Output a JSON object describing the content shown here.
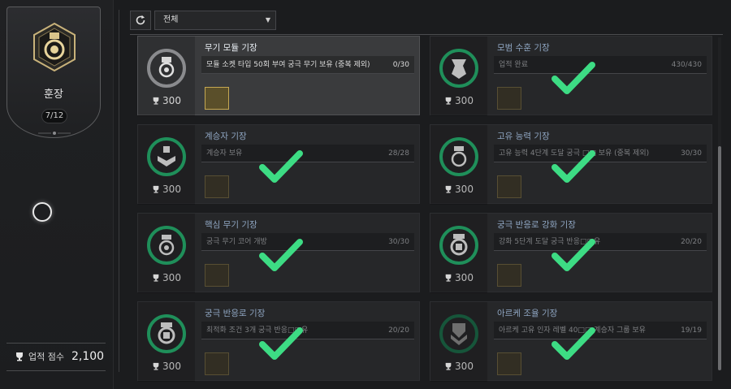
{
  "medal": {
    "title": "훈장",
    "count": "7/12"
  },
  "score": {
    "label": "업적 점수",
    "value": "2,100",
    "icon": "trophy-icon"
  },
  "filter": {
    "selected": "전체",
    "refresh_icon": "refresh-icon"
  },
  "colors": {
    "check": "#3ddc84",
    "emblem_ring": "#1f8f5a",
    "card_bg": "#262729"
  },
  "cards": [
    {
      "title": "무기 모듈 기장",
      "desc": "모듈 소켓 타입 50회 부여 궁극 무기 보유 (중복 제외)",
      "progress": "0/30",
      "reward": "300",
      "completed": false,
      "selected": true
    },
    {
      "title": "모범 수훈 기장",
      "desc": "업적 완료",
      "progress": "430/430",
      "reward": "300",
      "completed": true,
      "selected": false
    },
    {
      "title": "계승자 기장",
      "desc": "계승자 보유",
      "progress": "28/28",
      "reward": "300",
      "completed": true,
      "selected": false
    },
    {
      "title": "고유 능력 기장",
      "desc": "고유 능력 4단계 도달 궁극 □□ 보유 (중복 제외)",
      "progress": "30/30",
      "reward": "300",
      "completed": true,
      "selected": false
    },
    {
      "title": "핵심 무기 기장",
      "desc": "궁극 무기 코어 개방",
      "progress": "30/30",
      "reward": "300",
      "completed": true,
      "selected": false
    },
    {
      "title": "궁극 반응로 강화 기장",
      "desc": "강화 5단계 도달 궁극 반응□□유",
      "progress": "20/20",
      "reward": "300",
      "completed": true,
      "selected": false
    },
    {
      "title": "궁극 반응로 기장",
      "desc": "최적화 조건 3개 궁극 반응□□유",
      "progress": "20/20",
      "reward": "300",
      "completed": true,
      "selected": false
    },
    {
      "title": "아르케 조율 기장",
      "desc": "아르케 고유 인자 레벨 40□□ 계승자 그룹 보유",
      "progress": "19/19",
      "reward": "300",
      "completed": true,
      "selected": false
    }
  ]
}
